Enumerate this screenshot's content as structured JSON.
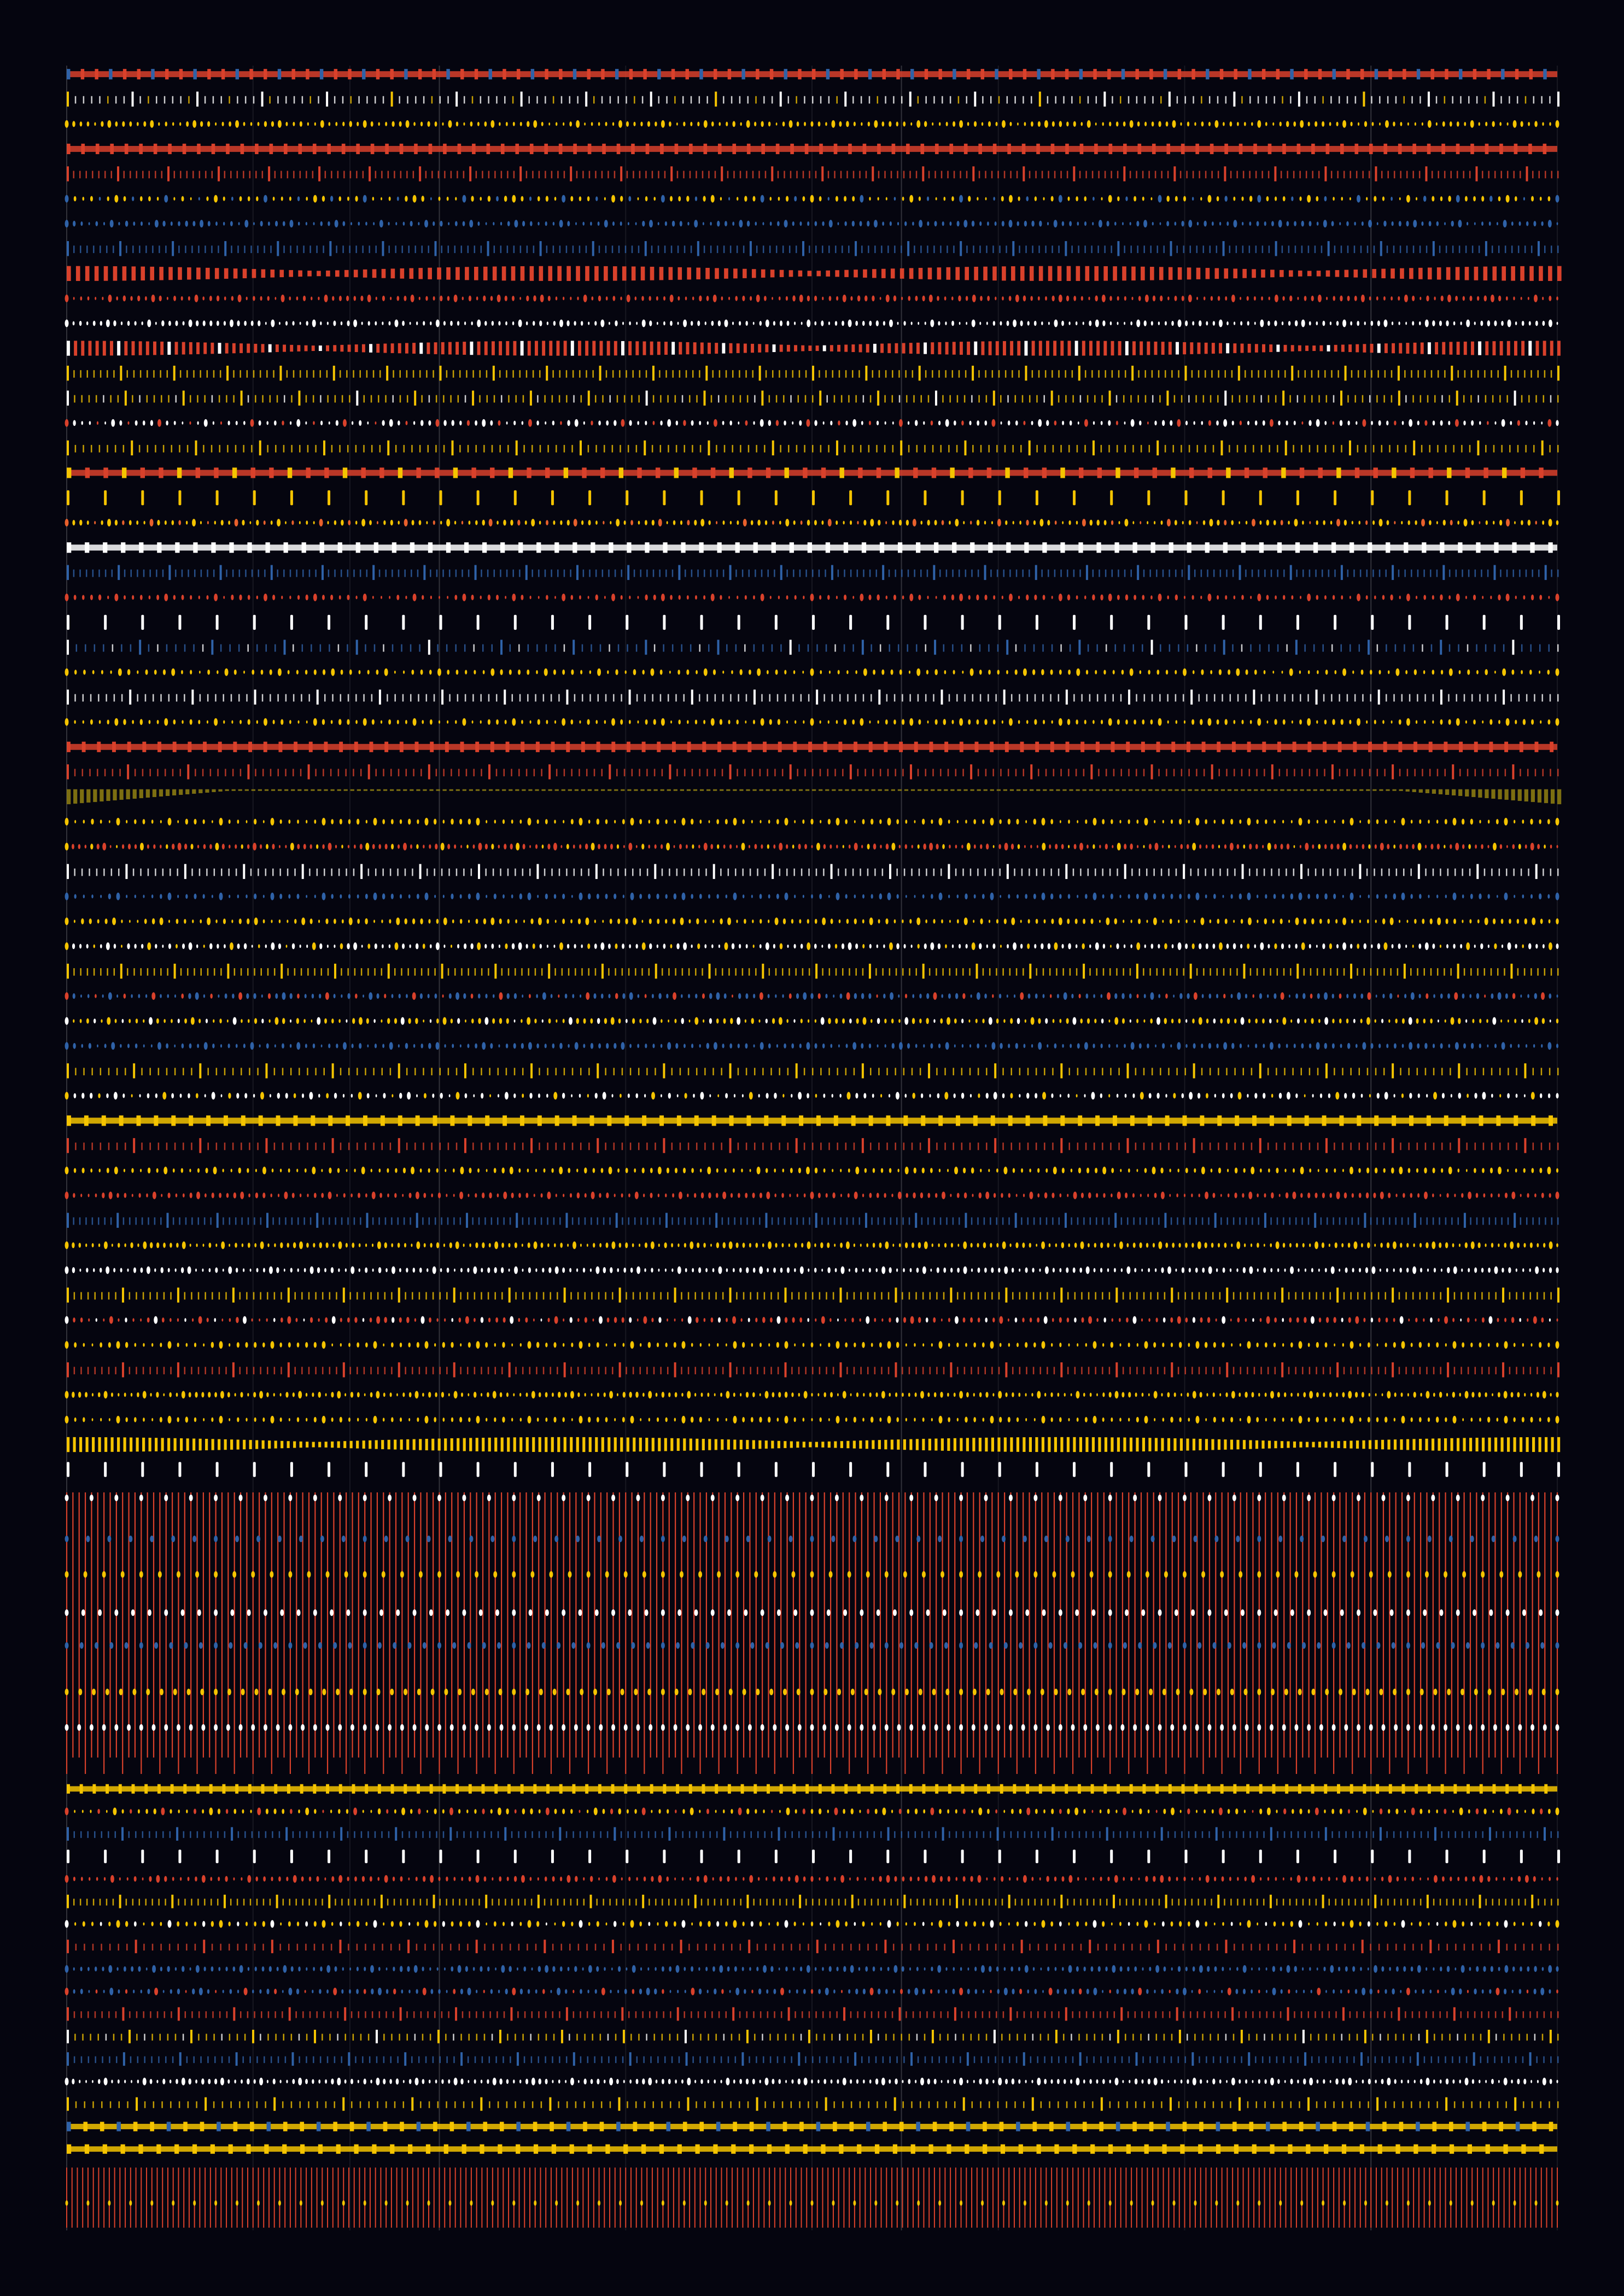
{
  "artwork": {
    "background": "#05050f",
    "palette": {
      "red": "#d9412b",
      "orange": "#e8602c",
      "yellow": "#f5c400",
      "blue": "#2f62a8",
      "white": "#ffffff",
      "olive": "#8a7a12"
    },
    "rows": [
      {
        "kind": "band",
        "color": "red",
        "accent": "blue"
      },
      {
        "kind": "ticks",
        "color": "white",
        "accent": "yellow"
      },
      {
        "kind": "dots",
        "color": "yellow"
      },
      {
        "kind": "band",
        "color": "red"
      },
      {
        "kind": "ticks",
        "color": "red"
      },
      {
        "kind": "dots",
        "color": "yellow",
        "accent": "blue"
      },
      {
        "kind": "dots",
        "color": "blue"
      },
      {
        "kind": "ticks",
        "color": "blue"
      },
      {
        "kind": "wave",
        "color": "red"
      },
      {
        "kind": "dots",
        "color": "red"
      },
      {
        "kind": "dots",
        "color": "white"
      },
      {
        "kind": "wave",
        "color": "red",
        "accent": "white"
      },
      {
        "kind": "ticks",
        "color": "yellow"
      },
      {
        "kind": "ticks",
        "color": "yellow",
        "accent": "white"
      },
      {
        "kind": "dots",
        "color": "white",
        "accent": "red"
      },
      {
        "kind": "ticks",
        "color": "yellow"
      },
      {
        "kind": "band",
        "color": "red",
        "accent": "yellow"
      },
      {
        "kind": "sparse",
        "color": "yellow"
      },
      {
        "kind": "dots",
        "color": "yellow",
        "accent": "orange"
      },
      {
        "kind": "band",
        "color": "white"
      },
      {
        "kind": "ticks",
        "color": "blue"
      },
      {
        "kind": "dots",
        "color": "red"
      },
      {
        "kind": "sparse",
        "color": "white"
      },
      {
        "kind": "ticks",
        "color": "blue",
        "accent": "white"
      },
      {
        "kind": "dots",
        "color": "yellow"
      },
      {
        "kind": "ticks",
        "color": "white"
      },
      {
        "kind": "dots",
        "color": "yellow"
      },
      {
        "kind": "band",
        "color": "red"
      },
      {
        "kind": "ticks",
        "color": "red"
      },
      {
        "kind": "scallop",
        "color": "olive"
      },
      {
        "kind": "dots",
        "color": "yellow"
      },
      {
        "kind": "dots",
        "color": "red",
        "accent": "yellow"
      },
      {
        "kind": "ticks",
        "color": "white"
      },
      {
        "kind": "dots",
        "color": "blue"
      },
      {
        "kind": "dots",
        "color": "yellow"
      },
      {
        "kind": "dots",
        "color": "white",
        "accent": "yellow"
      },
      {
        "kind": "ticks",
        "color": "yellow"
      },
      {
        "kind": "dots",
        "color": "blue",
        "accent": "red"
      },
      {
        "kind": "dots",
        "color": "yellow",
        "accent": "white"
      },
      {
        "kind": "dots",
        "color": "blue"
      },
      {
        "kind": "ticks",
        "color": "yellow"
      },
      {
        "kind": "dots",
        "color": "white",
        "accent": "yellow"
      },
      {
        "kind": "band",
        "color": "yellow"
      },
      {
        "kind": "ticks",
        "color": "red"
      },
      {
        "kind": "dots",
        "color": "yellow"
      },
      {
        "kind": "dots",
        "color": "red"
      },
      {
        "kind": "ticks",
        "color": "blue"
      },
      {
        "kind": "dots",
        "color": "yellow"
      },
      {
        "kind": "dots",
        "color": "white"
      },
      {
        "kind": "ticks",
        "color": "yellow"
      },
      {
        "kind": "dots",
        "color": "red",
        "accent": "white"
      },
      {
        "kind": "dots",
        "color": "yellow"
      },
      {
        "kind": "ticks",
        "color": "red"
      },
      {
        "kind": "dots",
        "color": "yellow"
      },
      {
        "kind": "dots",
        "color": "yellow"
      },
      {
        "kind": "wave",
        "color": "yellow"
      },
      {
        "kind": "sparse",
        "color": "white"
      }
    ],
    "curtain": {
      "color": "red",
      "accents": [
        "white",
        "blue",
        "yellow"
      ]
    },
    "rows_bottom": [
      {
        "kind": "band",
        "color": "yellow"
      },
      {
        "kind": "dots",
        "color": "yellow",
        "accent": "red"
      },
      {
        "kind": "ticks",
        "color": "blue"
      },
      {
        "kind": "sparse",
        "color": "white"
      },
      {
        "kind": "dots",
        "color": "red"
      },
      {
        "kind": "ticks",
        "color": "yellow"
      },
      {
        "kind": "dots",
        "color": "yellow",
        "accent": "white"
      },
      {
        "kind": "ticks",
        "color": "red"
      },
      {
        "kind": "dots",
        "color": "blue"
      },
      {
        "kind": "dots",
        "color": "blue",
        "accent": "red"
      },
      {
        "kind": "ticks",
        "color": "red"
      },
      {
        "kind": "ticks",
        "color": "yellow",
        "accent": "white"
      },
      {
        "kind": "ticks",
        "color": "blue"
      },
      {
        "kind": "dots",
        "color": "white"
      },
      {
        "kind": "ticks",
        "color": "yellow"
      },
      {
        "kind": "band",
        "color": "yellow",
        "accent": "blue"
      },
      {
        "kind": "band",
        "color": "yellow"
      }
    ],
    "comb": {
      "color": "red",
      "accent": "yellow"
    }
  }
}
